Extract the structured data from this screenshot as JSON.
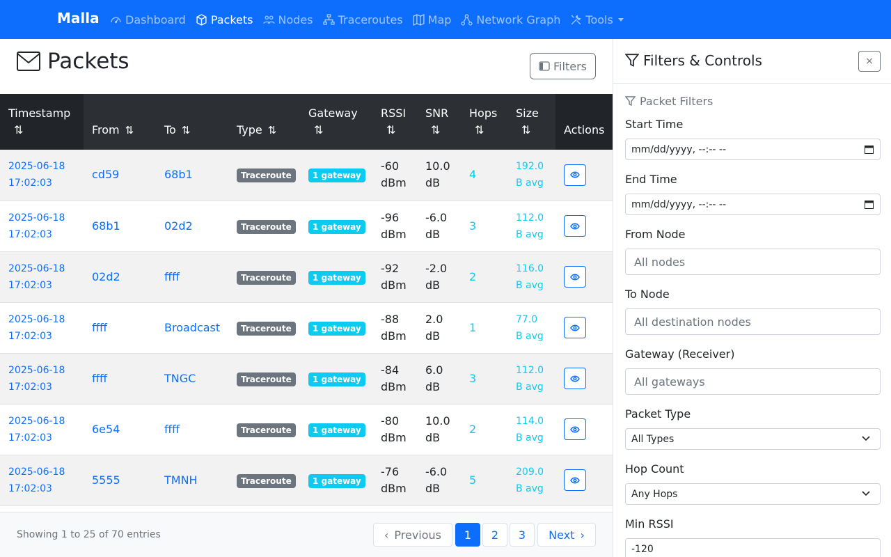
{
  "brand": "Malla",
  "nav": [
    {
      "label": "Dashboard",
      "icon": "speedometer-icon",
      "active": false
    },
    {
      "label": "Packets",
      "icon": "box-icon",
      "active": true
    },
    {
      "label": "Nodes",
      "icon": "nodes-icon",
      "active": false
    },
    {
      "label": "Traceroutes",
      "icon": "diagram-icon",
      "active": false
    },
    {
      "label": "Map",
      "icon": "map-icon",
      "active": false
    },
    {
      "label": "Network Graph",
      "icon": "network-icon",
      "active": false
    },
    {
      "label": "Tools",
      "icon": "tools-icon",
      "active": false
    }
  ],
  "page": {
    "title": "Packets",
    "filters_button": "Filters"
  },
  "table": {
    "headers": {
      "timestamp": "Timestamp",
      "from": "From",
      "to": "To",
      "type": "Type",
      "gateway": "Gateway",
      "rssi": "RSSI",
      "snr": "SNR",
      "hops": "Hops",
      "size": "Size",
      "actions": "Actions"
    },
    "sort_glyph": "⇅",
    "rows": [
      {
        "date": "2025-06-18",
        "time": "17:02:03",
        "from": "cd59",
        "to": "68b1",
        "type": "Traceroute",
        "gateway": "1 gateway",
        "rssi": "-60",
        "rssi_unit": "dBm",
        "snr": "10.0",
        "snr_unit": "dB",
        "hops": "4",
        "size": "192.0",
        "size_unit": "B avg"
      },
      {
        "date": "2025-06-18",
        "time": "17:02:03",
        "from": "68b1",
        "to": "02d2",
        "type": "Traceroute",
        "gateway": "1 gateway",
        "rssi": "-96",
        "rssi_unit": "dBm",
        "snr": "-6.0",
        "snr_unit": "dB",
        "hops": "3",
        "size": "112.0",
        "size_unit": "B avg"
      },
      {
        "date": "2025-06-18",
        "time": "17:02:03",
        "from": "02d2",
        "to": "ffff",
        "type": "Traceroute",
        "gateway": "1 gateway",
        "rssi": "-92",
        "rssi_unit": "dBm",
        "snr": "-2.0",
        "snr_unit": "dB",
        "hops": "2",
        "size": "116.0",
        "size_unit": "B avg"
      },
      {
        "date": "2025-06-18",
        "time": "17:02:03",
        "from": "ffff",
        "to": "Broadcast",
        "type": "Traceroute",
        "gateway": "1 gateway",
        "rssi": "-88",
        "rssi_unit": "dBm",
        "snr": "2.0",
        "snr_unit": "dB",
        "hops": "1",
        "size": "77.0",
        "size_unit": "B avg"
      },
      {
        "date": "2025-06-18",
        "time": "17:02:03",
        "from": "ffff",
        "to": "TNGC",
        "type": "Traceroute",
        "gateway": "1 gateway",
        "rssi": "-84",
        "rssi_unit": "dBm",
        "snr": "6.0",
        "snr_unit": "dB",
        "hops": "3",
        "size": "112.0",
        "size_unit": "B avg"
      },
      {
        "date": "2025-06-18",
        "time": "17:02:03",
        "from": "6e54",
        "to": "ffff",
        "type": "Traceroute",
        "gateway": "1 gateway",
        "rssi": "-80",
        "rssi_unit": "dBm",
        "snr": "10.0",
        "snr_unit": "dB",
        "hops": "2",
        "size": "114.0",
        "size_unit": "B avg"
      },
      {
        "date": "2025-06-18",
        "time": "17:02:03",
        "from": "5555",
        "to": "TMNH",
        "type": "Traceroute",
        "gateway": "1 gateway",
        "rssi": "-76",
        "rssi_unit": "dBm",
        "snr": "-6.0",
        "snr_unit": "dB",
        "hops": "5",
        "size": "209.0",
        "size_unit": "B avg"
      }
    ]
  },
  "footer": {
    "showing": "Showing 1 to 25 of 70 entries",
    "previous": "Previous",
    "next": "Next",
    "pages": [
      "1",
      "2",
      "3"
    ],
    "current_page": "1"
  },
  "sidebar": {
    "title": "Filters & Controls",
    "close": "×",
    "section": "Packet Filters",
    "start_time": {
      "label": "Start Time",
      "placeholder": "mm/dd/yyyy, --:-- --"
    },
    "end_time": {
      "label": "End Time",
      "placeholder": "mm/dd/yyyy, --:-- --"
    },
    "from_node": {
      "label": "From Node",
      "placeholder": "All nodes"
    },
    "to_node": {
      "label": "To Node",
      "placeholder": "All destination nodes"
    },
    "gateway": {
      "label": "Gateway (Receiver)",
      "placeholder": "All gateways"
    },
    "packet_type": {
      "label": "Packet Type",
      "value": "All Types"
    },
    "hop_count": {
      "label": "Hop Count",
      "value": "Any Hops"
    },
    "min_rssi": {
      "label": "Min RSSI",
      "value": "-120"
    }
  },
  "colors": {
    "primary": "#0d6efd",
    "info": "#0dcaf0",
    "secondary": "#6c757d",
    "dark": "#212529"
  }
}
